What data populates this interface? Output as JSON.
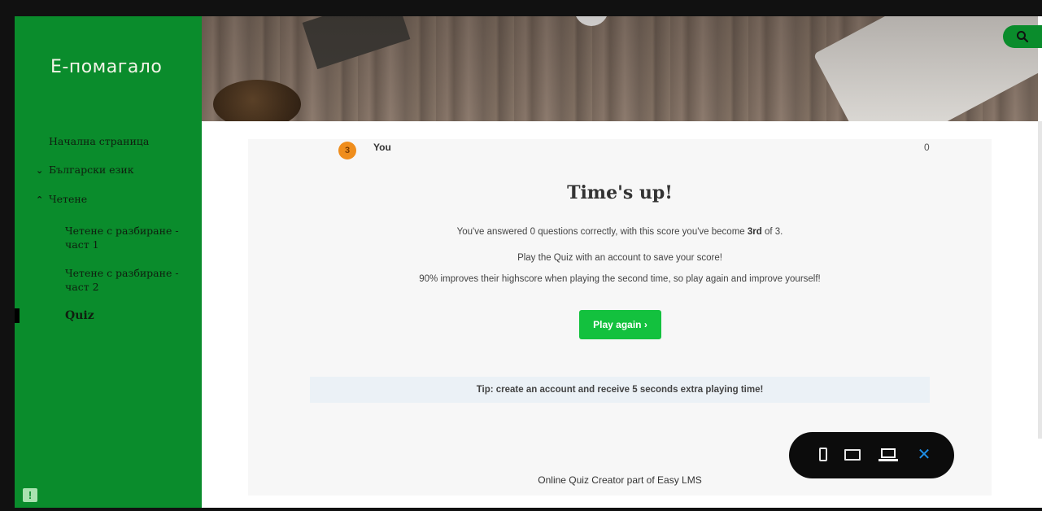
{
  "sidebar": {
    "site_title": "Е-помагало",
    "items": [
      {
        "label": "Начална страница"
      },
      {
        "label": "Български език",
        "caret": "⌄"
      },
      {
        "label": "Четене",
        "caret": "⌃"
      },
      {
        "label": "Четене с разбиране - част 1"
      },
      {
        "label": "Четене с разбиране - част 2"
      },
      {
        "label": "Quiz"
      }
    ],
    "active_item": "Quiz",
    "feedback_icon": "!"
  },
  "header": {
    "search_icon": "search-icon"
  },
  "quiz": {
    "leaderboard_row": {
      "rank": "3",
      "name": "You",
      "score": "0"
    },
    "heading": "Time's up!",
    "result_prefix": "You've answered 0 questions correctly, with this score you've become ",
    "result_rank": "3rd",
    "result_suffix": " of 3.",
    "save_prompt": "Play the Quiz with an account to save your score!",
    "improve_text": "90% improves their highscore when playing the second time, so play again and improve yourself!",
    "play_again_label": "Play again ›",
    "tip": "Tip: create an account and receive 5 seconds extra playing time!",
    "credit": "Online Quiz Creator part of Easy LMS"
  },
  "device_toolbar": {
    "buttons": [
      "phone-icon",
      "tablet-icon",
      "desktop-icon"
    ],
    "close_label": "✕",
    "selected": "desktop-icon"
  },
  "colors": {
    "sidebar": "#0a8c2c",
    "primary_button": "#13c13e",
    "tip_background": "#ebf1f6",
    "close_accent": "#1e8fe8"
  }
}
